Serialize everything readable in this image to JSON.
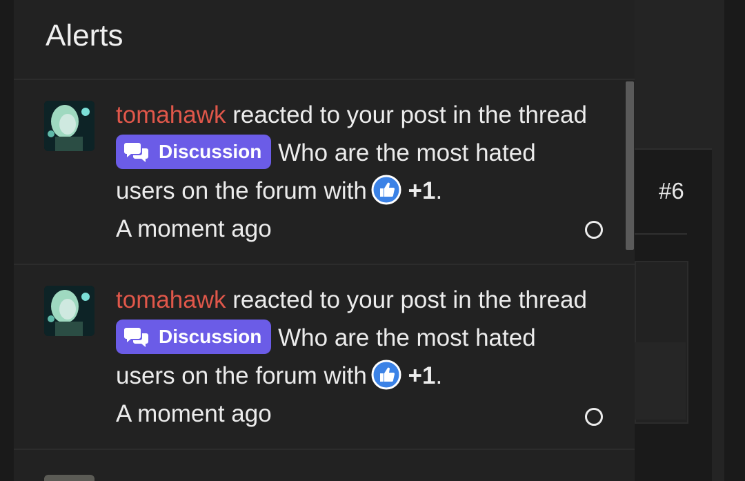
{
  "panel": {
    "title": "Alerts"
  },
  "alerts": [
    {
      "username": "tomahawk",
      "action_text": "reacted to your post in the thread",
      "prefix_label": "Discussion",
      "thread_title": "Who are the most hated users on the forum",
      "with_text": "with",
      "reaction": "+1",
      "period": ".",
      "time": "A moment ago"
    },
    {
      "username": "tomahawk",
      "action_text": "reacted to your post in the thread",
      "prefix_label": "Discussion",
      "thread_title": "Who are the most hated users on the forum",
      "with_text": "with",
      "reaction": "+1",
      "period": ".",
      "time": "A moment ago"
    }
  ],
  "background": {
    "post_number": "#6"
  },
  "colors": {
    "username": "#e0574a",
    "prefix_badge": "#6b5ce7",
    "like_icon": "#3b82e6",
    "panel_bg": "#222222"
  },
  "icons": {
    "prefix": "chat-bubbles-icon",
    "reaction": "thumbs-up-icon",
    "mark_read": "circle-outline-icon"
  }
}
